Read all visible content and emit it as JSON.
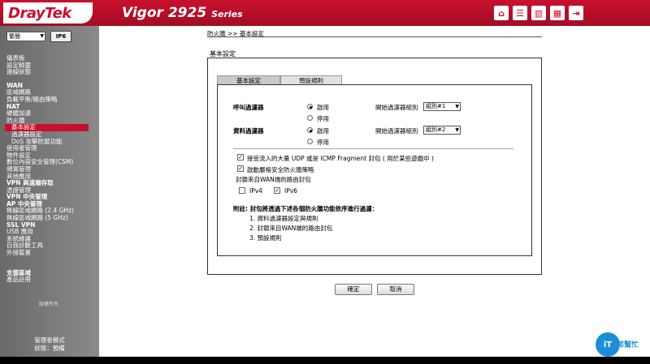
{
  "header": {
    "logo": "DrayTek",
    "model": "Vigor 2925",
    "model_suffix": "Series",
    "icons": [
      "home-icon",
      "list-icon",
      "chart-icon",
      "grid-icon",
      "logout-icon"
    ]
  },
  "sidebar": {
    "language": "繁簡",
    "ipv6_badge": "IP6",
    "menu": [
      {
        "label": "儀表板",
        "type": "item"
      },
      {
        "label": "設定精靈",
        "type": "item"
      },
      {
        "label": "連線狀態",
        "type": "item"
      },
      {
        "type": "gap"
      },
      {
        "label": "WAN",
        "type": "bold"
      },
      {
        "label": "區域網路",
        "type": "item"
      },
      {
        "label": "負載平衡/路由策略",
        "type": "item"
      },
      {
        "label": "NAT",
        "type": "bold"
      },
      {
        "label": "硬體加速",
        "type": "item"
      },
      {
        "label": "防火牆",
        "type": "item"
      },
      {
        "label": "基本設定",
        "type": "sub-active"
      },
      {
        "label": "過濾器設定",
        "type": "sub"
      },
      {
        "label": "DoS 攻擊防禦功能",
        "type": "sub"
      },
      {
        "label": "使用者管理",
        "type": "item"
      },
      {
        "label": "物件設定",
        "type": "item"
      },
      {
        "label": "數位內容安全管理(CSM)",
        "type": "item"
      },
      {
        "label": "頻寬管理",
        "type": "item"
      },
      {
        "label": "其他應用",
        "type": "item"
      },
      {
        "label": "VPN 與遠端存取",
        "type": "bold"
      },
      {
        "label": "憑證管理",
        "type": "item"
      },
      {
        "label": "VPN 中央管理",
        "type": "bold"
      },
      {
        "label": "AP 中央管理",
        "type": "bold"
      },
      {
        "label": "無線區域網路 (2.4 GHz)",
        "type": "item"
      },
      {
        "label": "無線區域網路 (5 GHz)",
        "type": "item"
      },
      {
        "label": "SSL VPN",
        "type": "bold"
      },
      {
        "label": "USB 應用",
        "type": "item"
      },
      {
        "label": "系統維護",
        "type": "item"
      },
      {
        "label": "自我診斷工具",
        "type": "item"
      },
      {
        "label": "外接裝置",
        "type": "item"
      },
      {
        "type": "gap"
      },
      {
        "type": "gap"
      },
      {
        "label": "支援區域",
        "type": "bold"
      },
      {
        "label": "產品註冊",
        "type": "item"
      }
    ],
    "copyright": "版權所有",
    "admin_mode": "管理者模式",
    "status": "狀態：預備"
  },
  "main": {
    "breadcrumb": "防火牆 >> 基本設定",
    "panel_title": "基本設定",
    "tabs": [
      "基本設定",
      "預設規則"
    ],
    "call_filter": {
      "label": "呼叫過濾器",
      "enable": "啟用",
      "disable": "停用",
      "start_label": "開始過濾器組別",
      "start_value": "組別#1"
    },
    "data_filter": {
      "label": "資料過濾器",
      "enable": "啟用",
      "disable": "停用",
      "start_label": "開始過濾器組別",
      "start_value": "組別#2"
    },
    "opt_udp": "接受流入的大量 UDP 或是 ICMP Fragment 封包 ( 用於某些遊戲中 )",
    "opt_strict": "啟動嚴格安全防火牆策略",
    "block_wan": "封鎖來自WAN端的路由封包",
    "ipv4": "IPv4",
    "ipv6": "IPv6",
    "note_title": "附註: 封包將透過下述各個防火牆功能依序進行過濾：",
    "notes": [
      "1. 資料過濾器設定與規則",
      "2. 封鎖來自WAN端的路由封包",
      "3. 預設規則"
    ],
    "ok": "確定",
    "cancel": "取消"
  },
  "watermark": {
    "badge": "iT",
    "text": "邦幫忙"
  }
}
